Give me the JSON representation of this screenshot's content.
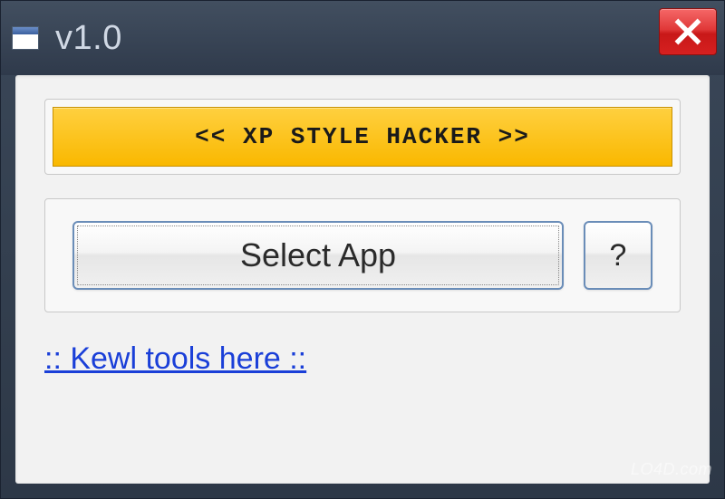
{
  "window": {
    "title": "v1.0",
    "close_label": "Close"
  },
  "banner": {
    "text": "<< XP STYLE HACKER >>"
  },
  "buttons": {
    "select_app": "Select App",
    "help": "?"
  },
  "link": {
    "text": ":: Kewl tools here ::"
  },
  "watermark": "LO4D.com"
}
